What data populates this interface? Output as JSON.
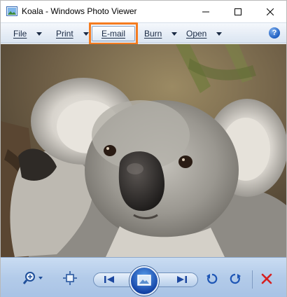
{
  "window": {
    "title": "Koala - Windows Photo Viewer",
    "app_icon": "photo-viewer-icon",
    "controls": [
      "minimize-icon",
      "maximize-icon",
      "close-icon"
    ]
  },
  "menubar": {
    "items": [
      {
        "label": "File",
        "has_dropdown": true
      },
      {
        "label": "Print",
        "has_dropdown": true
      },
      {
        "label": "E-mail",
        "has_dropdown": false,
        "highlighted": true
      },
      {
        "label": "Burn",
        "has_dropdown": true
      },
      {
        "label": "Open",
        "has_dropdown": true
      }
    ],
    "help_icon": "help-icon",
    "help_glyph": "?"
  },
  "photo": {
    "subject": "koala"
  },
  "toolbar": {
    "buttons": [
      "zoom-icon",
      "actual-size-icon",
      "previous-icon",
      "slideshow-icon",
      "next-icon",
      "rotate-left-icon",
      "rotate-right-icon",
      "delete-icon"
    ]
  },
  "colors": {
    "highlight": "#f57c20",
    "menubar_text": "#1a2a44",
    "toolbar_bg": "#b3cbe9",
    "delete": "#d62020",
    "accent_blue": "#1f5fc2"
  }
}
